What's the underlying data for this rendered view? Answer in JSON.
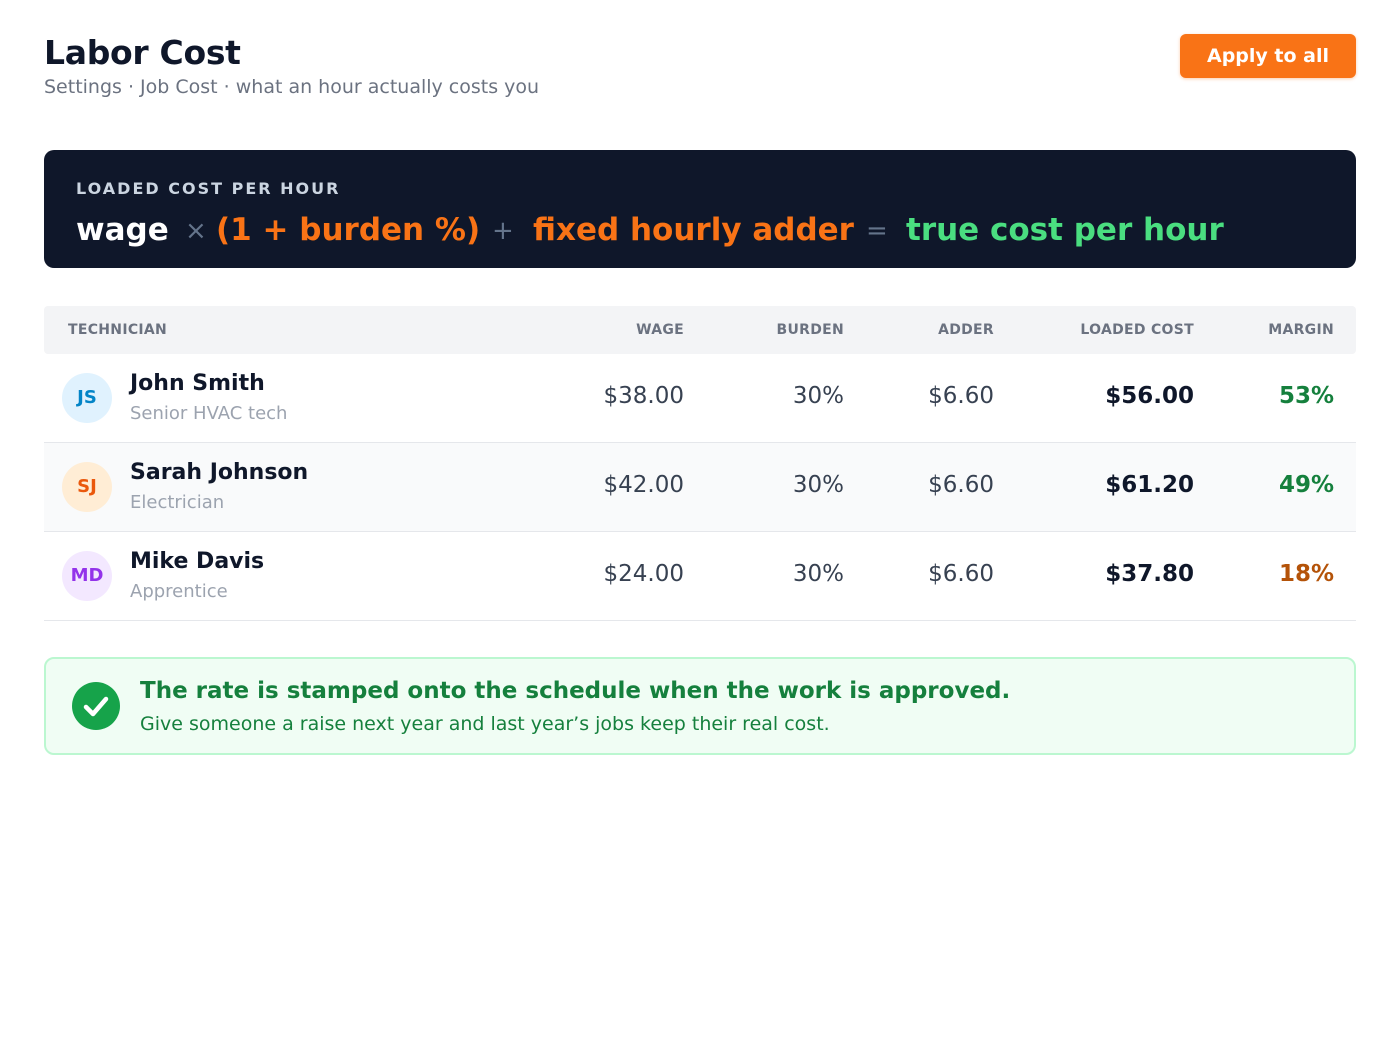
{
  "header": {
    "title": "Labor Cost",
    "subtitle": "Settings · Job Cost · what an hour actually costs you",
    "apply_label": "Apply to all"
  },
  "formula": {
    "label": "LOADED COST PER HOUR",
    "wage": "wage",
    "times": "×",
    "burden": "(1 + burden %)",
    "plus": "+",
    "adder": "fixed hourly adder",
    "equals": "=",
    "result": "true cost per hour"
  },
  "table": {
    "columns": {
      "technician": "TECHNICIAN",
      "wage": "WAGE",
      "burden": "BURDEN",
      "adder": "ADDER",
      "loaded": "LOADED COST",
      "margin": "MARGIN"
    },
    "rows": [
      {
        "initials": "JS",
        "name": "John Smith",
        "role": "Senior HVAC tech",
        "wage": "$38.00",
        "burden": "30%",
        "adder": "$6.60",
        "loaded": "$56.00",
        "margin": "53%"
      },
      {
        "initials": "SJ",
        "name": "Sarah Johnson",
        "role": "Electrician",
        "wage": "$42.00",
        "burden": "30%",
        "adder": "$6.60",
        "loaded": "$61.20",
        "margin": "49%"
      },
      {
        "initials": "MD",
        "name": "Mike Davis",
        "role": "Apprentice",
        "wage": "$24.00",
        "burden": "30%",
        "adder": "$6.60",
        "loaded": "$37.80",
        "margin": "18%"
      }
    ]
  },
  "note": {
    "title": "The rate is stamped onto the schedule when the work is approved.",
    "body": "Give someone a raise next year and last year’s jobs keep their real cost."
  },
  "colors": {
    "accent": "#f97316",
    "dark_panel": "#0f172a",
    "result_green": "#4ade80",
    "margin_good": "#15803d",
    "margin_low": "#b45309"
  }
}
